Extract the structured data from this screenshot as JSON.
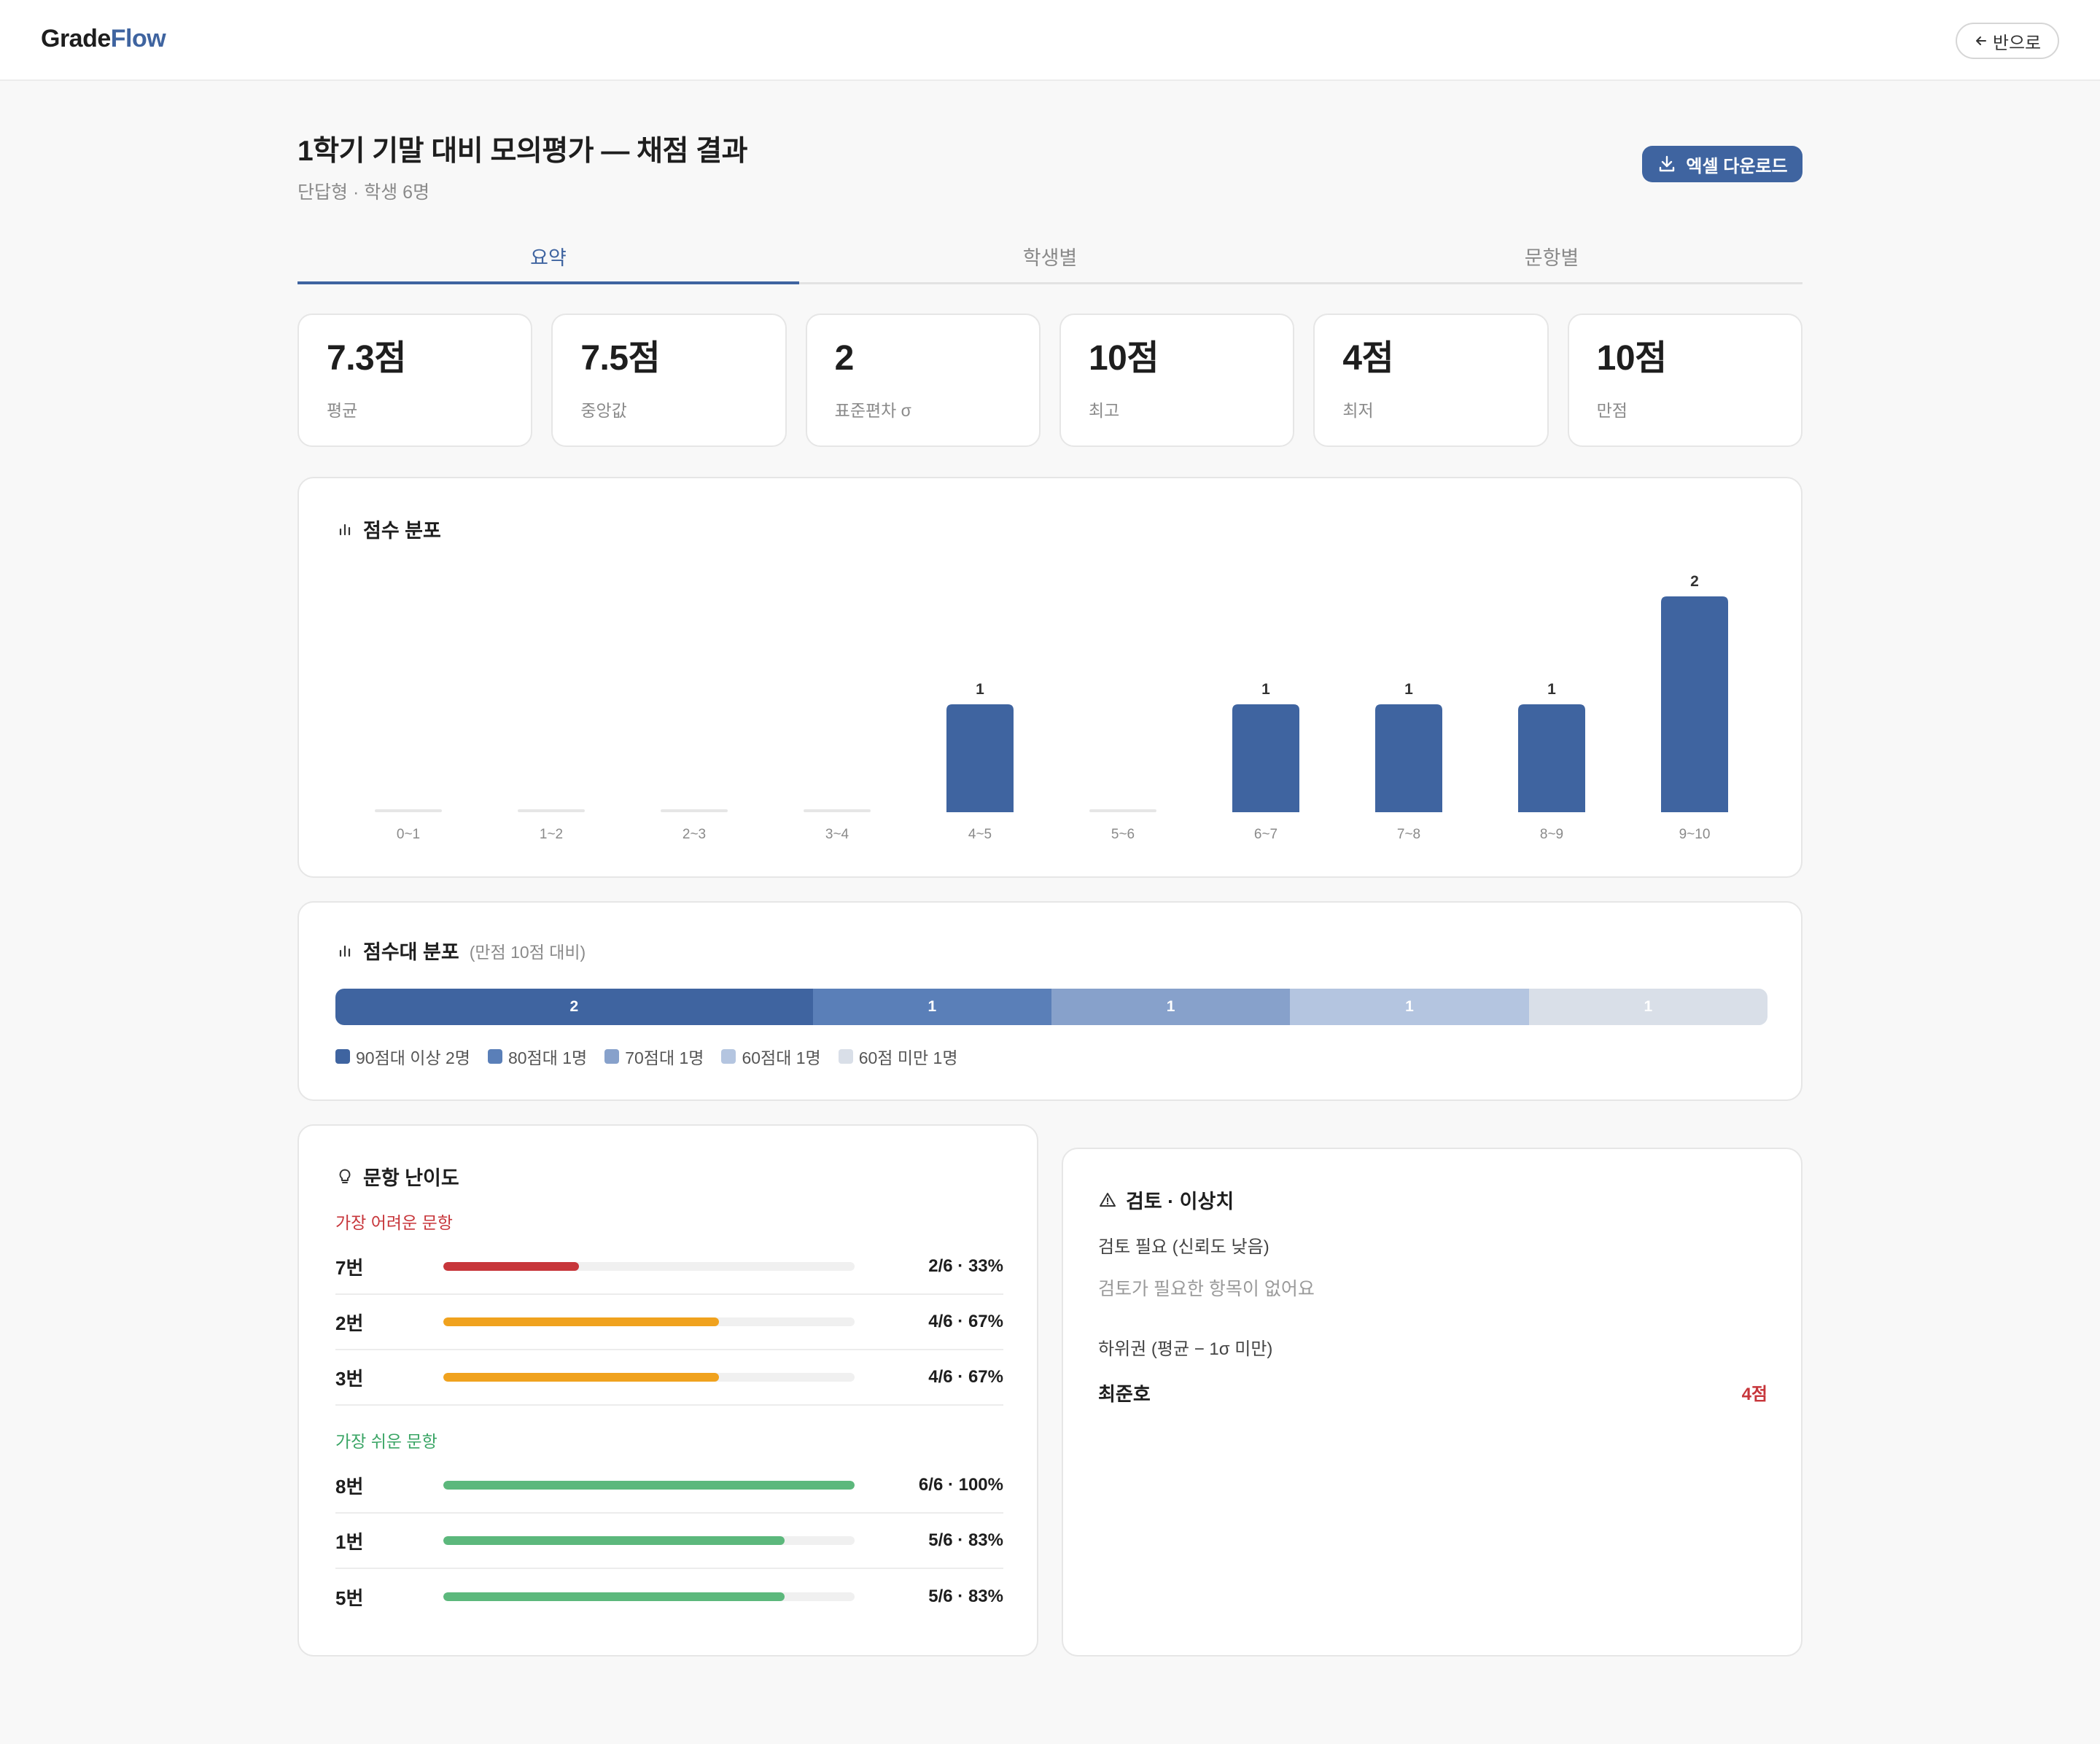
{
  "app": {
    "logo_part1": "Grade",
    "logo_part2": "Flow",
    "back_label": "반으로"
  },
  "header": {
    "title": "1학기 기말 대비 모의평가 — 채점 결과",
    "subtitle": "단답형 · 학생 6명",
    "download_label": "엑셀 다운로드"
  },
  "tabs": [
    {
      "label": "요약",
      "active": true
    },
    {
      "label": "학생별",
      "active": false
    },
    {
      "label": "문항별",
      "active": false
    }
  ],
  "stats": [
    {
      "value": "7.3점",
      "label": "평균"
    },
    {
      "value": "7.5점",
      "label": "중앙값"
    },
    {
      "value": "2",
      "label": "표준편차 σ"
    },
    {
      "value": "10점",
      "label": "최고"
    },
    {
      "value": "4점",
      "label": "최저"
    },
    {
      "value": "10점",
      "label": "만점"
    }
  ],
  "histogram": {
    "title": "점수 분포",
    "icon": "bar-chart-icon"
  },
  "chart_data": {
    "type": "bar",
    "categories": [
      "0~1",
      "1~2",
      "2~3",
      "3~4",
      "4~5",
      "5~6",
      "6~7",
      "7~8",
      "8~9",
      "9~10"
    ],
    "values": [
      0,
      0,
      0,
      0,
      1,
      0,
      1,
      1,
      1,
      2
    ],
    "title": "점수 분포",
    "ylim": [
      0,
      2
    ],
    "grid": false,
    "color": "#3f64a0"
  },
  "bands": {
    "title": "점수대 분포",
    "note": "(만점 10점 대비)",
    "segments": [
      {
        "count": "2",
        "value": 2,
        "color": "#3f64a0",
        "legend": "90점대 이상 2명"
      },
      {
        "count": "1",
        "value": 1,
        "color": "#5a7fb8",
        "legend": "80점대 1명"
      },
      {
        "count": "1",
        "value": 1,
        "color": "#87a1cb",
        "legend": "70점대 1명"
      },
      {
        "count": "1",
        "value": 1,
        "color": "#b4c5e0",
        "legend": "60점대 1명"
      },
      {
        "count": "1",
        "value": 1,
        "color": "#d9dfe8",
        "legend": "60점 미만 1명"
      }
    ]
  },
  "difficulty": {
    "title": "문항 난이도",
    "hard_label": "가장 어려운 문항",
    "easy_label": "가장 쉬운 문항",
    "hard": [
      {
        "name": "7번",
        "ratio": 0.33,
        "value": "2/6 · 33%",
        "color": "#c7363b"
      },
      {
        "name": "2번",
        "ratio": 0.67,
        "value": "4/6 · 67%",
        "color": "#f0a21e"
      },
      {
        "name": "3번",
        "ratio": 0.67,
        "value": "4/6 · 67%",
        "color": "#f0a21e"
      }
    ],
    "easy": [
      {
        "name": "8번",
        "ratio": 1.0,
        "value": "6/6 · 100%",
        "color": "#5cb87c"
      },
      {
        "name": "1번",
        "ratio": 0.83,
        "value": "5/6 · 83%",
        "color": "#5cb87c"
      },
      {
        "name": "5번",
        "ratio": 0.83,
        "value": "5/6 · 83%",
        "color": "#5cb87c"
      }
    ]
  },
  "review": {
    "title": "검토 · 이상치",
    "needs_review_label": "검토 필요 (신뢰도 낮음)",
    "needs_review_empty": "검토가 필요한 항목이 없어요",
    "low_group_label": "하위권 (평균 − 1σ 미만)",
    "low_students": [
      {
        "name": "최준호",
        "score": "4점"
      }
    ]
  }
}
